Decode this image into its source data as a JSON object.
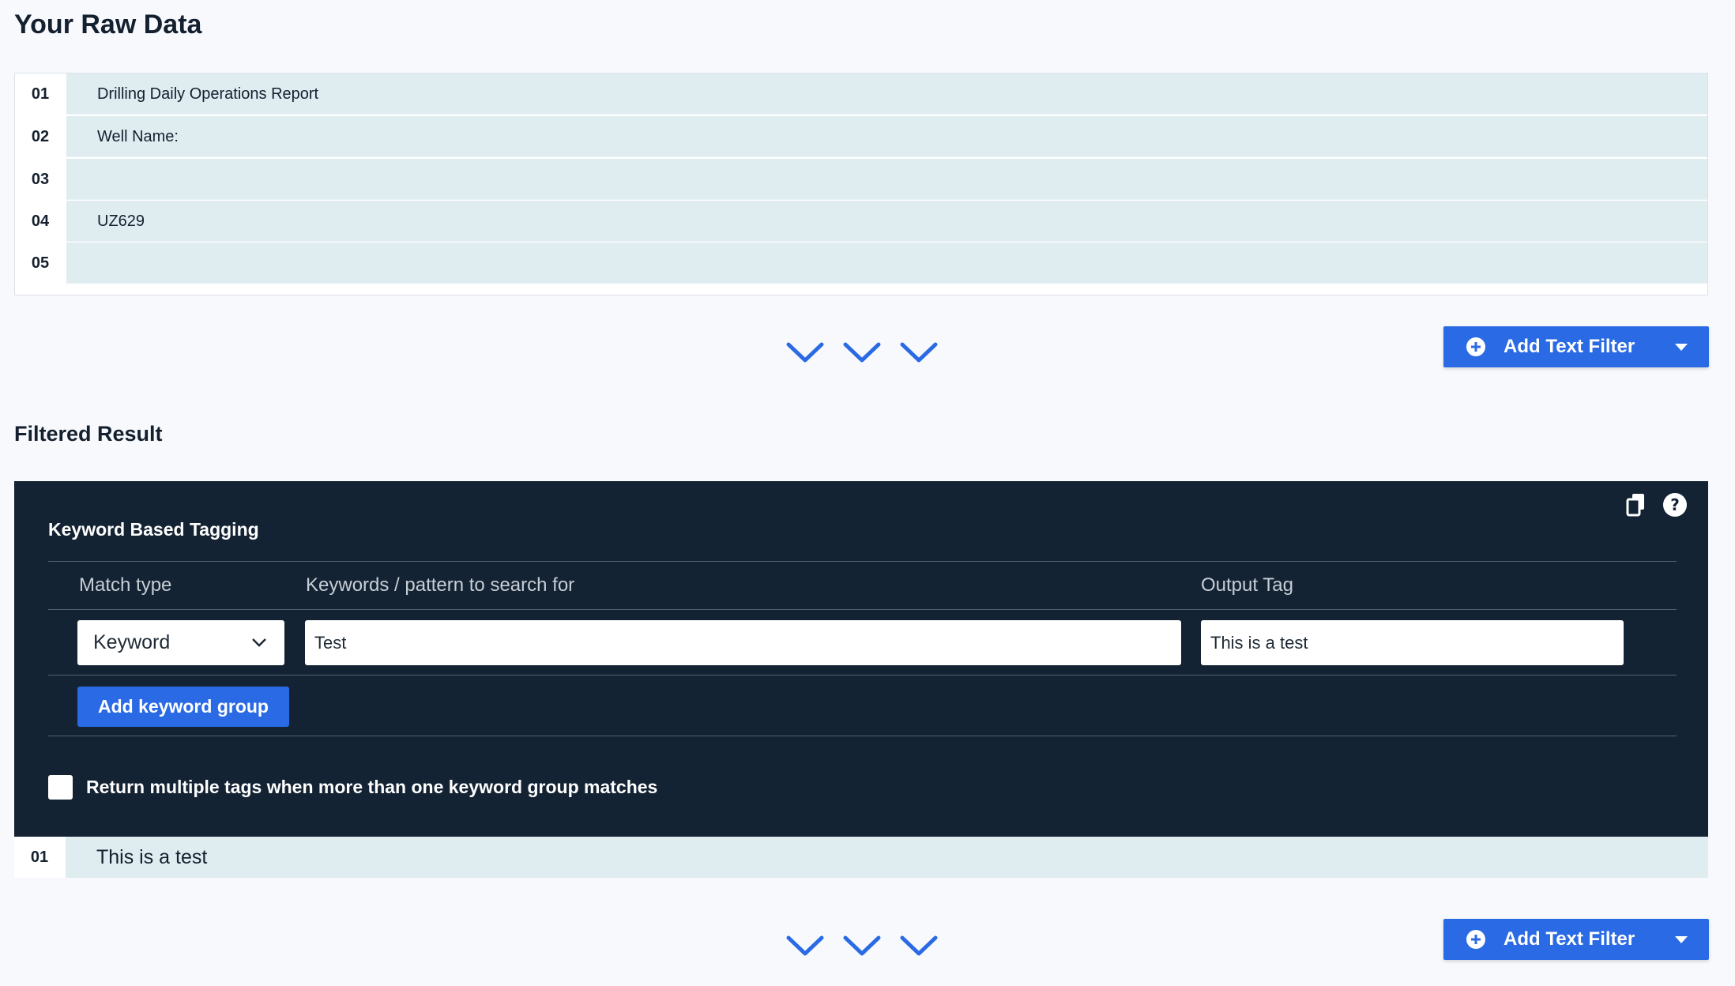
{
  "raw_section": {
    "title": "Your Raw Data",
    "rows": [
      {
        "num": "01",
        "text": "Drilling Daily Operations Report"
      },
      {
        "num": "02",
        "text": "Well Name:"
      },
      {
        "num": "03",
        "text": ""
      },
      {
        "num": "04",
        "text": "UZ629"
      },
      {
        "num": "05",
        "text": ""
      }
    ]
  },
  "add_filter": {
    "label": "Add Text Filter"
  },
  "filtered_section": {
    "title": "Filtered Result",
    "panel": {
      "title": "Keyword Based Tagging",
      "columns": {
        "match_type": "Match type",
        "keywords": "Keywords / pattern to search for",
        "output_tag": "Output Tag"
      },
      "match_type_value": "Keyword",
      "keywords_value": "Test",
      "output_tag_value": "This is a test",
      "add_group_label": "Add keyword group",
      "multi_tag_label": "Return multiple tags when more than one keyword group matches",
      "multi_tag_checked": false
    },
    "rows": [
      {
        "num": "01",
        "text": "This is a test"
      }
    ]
  },
  "colors": {
    "accent": "#2a6ae4",
    "panel_bg": "#142333",
    "row_bg": "#dfecf0"
  },
  "icons": [
    "chevron-down-icon",
    "plus-circle-icon",
    "caret-down-icon",
    "copy-icon",
    "help-icon"
  ]
}
